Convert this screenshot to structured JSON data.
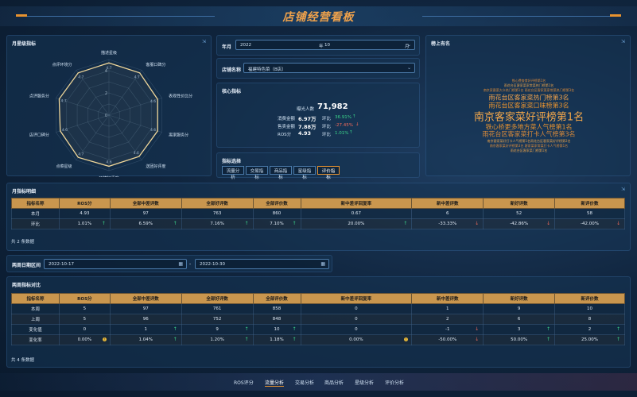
{
  "header": {
    "title": "店铺经营看板"
  },
  "radar": {
    "title": "月星级指标",
    "ticks": [
      "4",
      "2",
      "0"
    ],
    "axes": [
      {
        "label": "描述星级",
        "value": "4.7"
      },
      {
        "label": "客服口碑分",
        "value": "4.7"
      },
      {
        "label": "表现性价比分",
        "value": "4.6"
      },
      {
        "label": "离家服务分",
        "value": "4.6"
      },
      {
        "label": "送团好评度",
        "value": "4.6"
      },
      {
        "label": "环境好评度",
        "value": "4.6"
      },
      {
        "label": "点菜星级",
        "value": "4.7"
      },
      {
        "label": "店评口碑分",
        "value": "4.6"
      },
      {
        "label": "点评服务分",
        "value": "4.7"
      },
      {
        "label": "点评环境分",
        "value": "4.7"
      }
    ]
  },
  "filters": {
    "year_label": "年月",
    "year_value": "2022",
    "year_unit": "年",
    "month_value": "10",
    "month_unit": "月",
    "shop_label": "店铺名称",
    "shop_value": "福建特色菜（B店）"
  },
  "core": {
    "title": "核心指标",
    "exposure_label": "曝光人数",
    "exposure_value": "71,982",
    "rows": [
      {
        "label": "消费金额",
        "value": "6.97万",
        "cmp": "环比",
        "change": "36.91%",
        "dir": "up"
      },
      {
        "label": "售卖金额",
        "value": "7.88万",
        "cmp": "环比",
        "change": "-27.45%",
        "dir": "down"
      },
      {
        "label": "ROS分",
        "value": "4.93",
        "cmp": "环比",
        "change": "1.01%",
        "dir": "up"
      }
    ]
  },
  "indicator_select": {
    "title": "指标选择",
    "tabs": [
      "流量分析",
      "交易指标",
      "商品指标",
      "星级指标",
      "评价指标"
    ],
    "active": "评价指标"
  },
  "word_cloud": {
    "title": "榜上有名",
    "words": [
      {
        "text": "铁心费查食好评榜第1名",
        "size": 4,
        "color": "#d98a3a"
      },
      {
        "text": "雨花台区客家菜家常菜热门榜第1名",
        "size": 4,
        "color": "#e8a24a"
      },
      {
        "text": "南京家客菜大众热门榜第1名 雨花台区客家菜家常菜热门榜第3名",
        "size": 4,
        "color": "#d98a3a"
      },
      {
        "text": "雨花台区客家菜热门榜第3名",
        "size": 8,
        "color": "#f0a24b"
      },
      {
        "text": "雨花台区客家菜口味榜第3名",
        "size": 8,
        "color": "#e8932f"
      },
      {
        "text": "南京客家菜好评榜第1名",
        "size": 13,
        "color": "#f5a84a"
      },
      {
        "text": "铁心桥更多地方菜人气榜第1名",
        "size": 8,
        "color": "#e8932f"
      },
      {
        "text": "雨花台区客家菜打卡人气榜第3名",
        "size": 8,
        "color": "#d98a3a"
      },
      {
        "text": "南京客家菜好打卡人气榜第1名雨花台区客家菜好评榜第2名",
        "size": 4,
        "color": "#e8a24a"
      },
      {
        "text": "南京客家菜好评榜第3名 客家菜家常菜打卡人气榜第1名",
        "size": 4,
        "color": "#d98a3a"
      },
      {
        "text": "雨花台区客家菜门榜第1名",
        "size": 4,
        "color": "#e8a24a"
      }
    ]
  },
  "monthly_table": {
    "title": "月指标明细",
    "columns": [
      "指标名称",
      "ROS分",
      "全部中差评数",
      "全部好评数",
      "全部评价数",
      "新中差评回复率",
      "新中差评数",
      "新好评数",
      "新评价数"
    ],
    "rows": [
      {
        "cells": [
          "本月",
          "4.93",
          "97",
          "763",
          "860",
          "0.67",
          "6",
          "52",
          "58"
        ],
        "arrows": []
      },
      {
        "cells": [
          "环比",
          "1.01%",
          "6.59%",
          "7.16%",
          "7.10%",
          "20.00%",
          "-33.33%",
          "-42.86%",
          "-42.00%"
        ],
        "arrows": [
          "",
          "up",
          "up",
          "up",
          "up",
          "up",
          "down",
          "down",
          "down"
        ]
      }
    ],
    "count": "共 2 条数据"
  },
  "date_range": {
    "label": "两周日期区间",
    "start": "2022-10-17",
    "sep": "-",
    "end": "2022-10-30"
  },
  "biweekly_table": {
    "title": "两周指标对比",
    "columns": [
      "指标名称",
      "ROS分",
      "全部中差评数",
      "全部好评数",
      "全部评价数",
      "新中差评回复率",
      "新中差评数",
      "新好评数",
      "新评价数"
    ],
    "rows": [
      {
        "cells": [
          "本周",
          "5",
          "97",
          "761",
          "858",
          "0",
          "1",
          "9",
          "10"
        ],
        "arrows": []
      },
      {
        "cells": [
          "上周",
          "5",
          "96",
          "752",
          "848",
          "0",
          "2",
          "6",
          "8"
        ],
        "arrows": []
      },
      {
        "cells": [
          "变化值",
          "0",
          "1",
          "9",
          "10",
          "0",
          "-1",
          "3",
          "2"
        ],
        "arrows": [
          "",
          "",
          "up",
          "up",
          "up",
          "",
          "down",
          "up",
          "up"
        ]
      },
      {
        "cells": [
          "变化率",
          "0.00%",
          "1.04%",
          "1.20%",
          "1.18%",
          "0.00%",
          "-50.00%",
          "50.00%",
          "25.00%"
        ],
        "arrows": [
          "",
          "warn",
          "up",
          "up",
          "up",
          "warn",
          "down",
          "up",
          "up"
        ]
      }
    ],
    "count": "共 4 条数据"
  },
  "bottom_nav": {
    "items": [
      "ROS评分",
      "流量分析",
      "交易分析",
      "商品分析",
      "星级分析",
      "评价分析"
    ],
    "active": "流量分析"
  },
  "colors": {
    "accent": "#e8932f",
    "up": "#3bd48a",
    "down": "#f06a5a",
    "table_header": "#c9964e"
  }
}
